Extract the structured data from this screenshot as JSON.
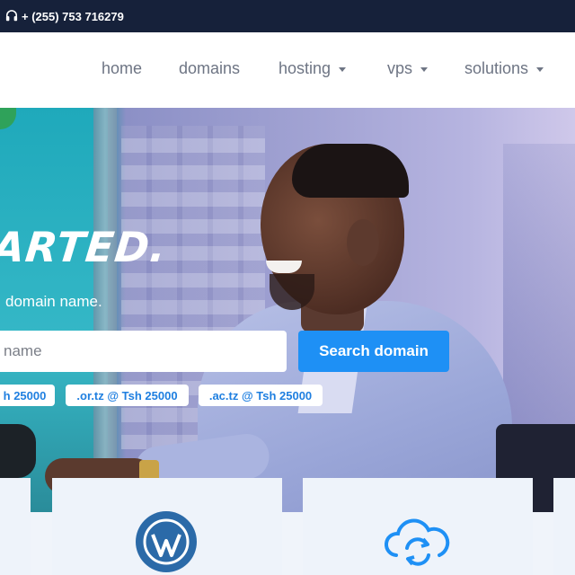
{
  "topbar": {
    "phone_icon": "headset-icon",
    "phone_text": "+ (255) 753 716279"
  },
  "nav": {
    "items": [
      {
        "label": "home",
        "has_dropdown": false
      },
      {
        "label": "domains",
        "has_dropdown": false
      },
      {
        "label": "hosting",
        "has_dropdown": true
      },
      {
        "label": "vps",
        "has_dropdown": true
      },
      {
        "label": "solutions",
        "has_dropdown": true
      }
    ]
  },
  "hero": {
    "headline": "ARTED.",
    "subline": "domain name.",
    "search": {
      "placeholder": "name",
      "button_label": "Search domain"
    },
    "chips": [
      {
        "label": "h 25000"
      },
      {
        "label": ".or.tz @ Tsh 25000"
      },
      {
        "label": ".ac.tz @ Tsh 25000"
      }
    ]
  },
  "cards": [
    {
      "icon": ""
    },
    {
      "icon": "wordpress-icon"
    },
    {
      "icon": "cloud-sync-icon"
    },
    {
      "icon": ""
    }
  ],
  "colors": {
    "topbar_bg": "#16213a",
    "accent": "#1e90f5",
    "nav_text": "#6e7584",
    "card_bg": "#eef3fa",
    "wordpress_blue": "#2b6aa8"
  }
}
